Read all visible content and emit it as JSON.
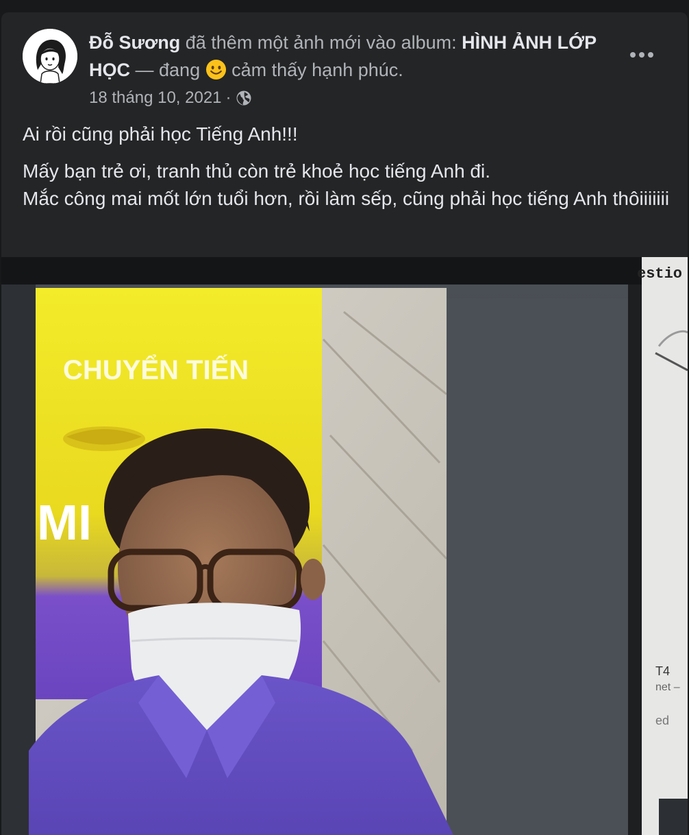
{
  "post": {
    "author": "Đỗ Sương",
    "action_text": "đã thêm một ảnh mới vào album:",
    "album": "HÌNH ẢNH LỚP HỌC",
    "feeling_prefix": "— đang",
    "feeling": "cảm thấy hạnh phúc.",
    "date": "18 tháng 10, 2021",
    "separator": "·",
    "privacy_icon": "globe-icon",
    "more_icon": "more-horizontal-icon",
    "text_line1": "Ai rồi cũng phải học Tiếng Anh!!!",
    "text_line2": "Mấy bạn trẻ ơi, tranh thủ còn trẻ khoẻ học tiếng Anh đi.",
    "text_line3": "Mắc công mai mốt lớn tuổi hơn, rồi làm sếp, cũng phải học tiếng Anh thôiiiiiii"
  },
  "photo": {
    "banner_text": "CHUYỂN TIẾN",
    "banner_text_short": "MI",
    "side_text_1": "estio",
    "side_text_2": "T4",
    "side_text_3": "net –",
    "side_text_4": "ed"
  },
  "colors": {
    "background": "#18191a",
    "card": "#242526",
    "primary_text": "#e4e6eb",
    "secondary_text": "#b0b3b8"
  }
}
